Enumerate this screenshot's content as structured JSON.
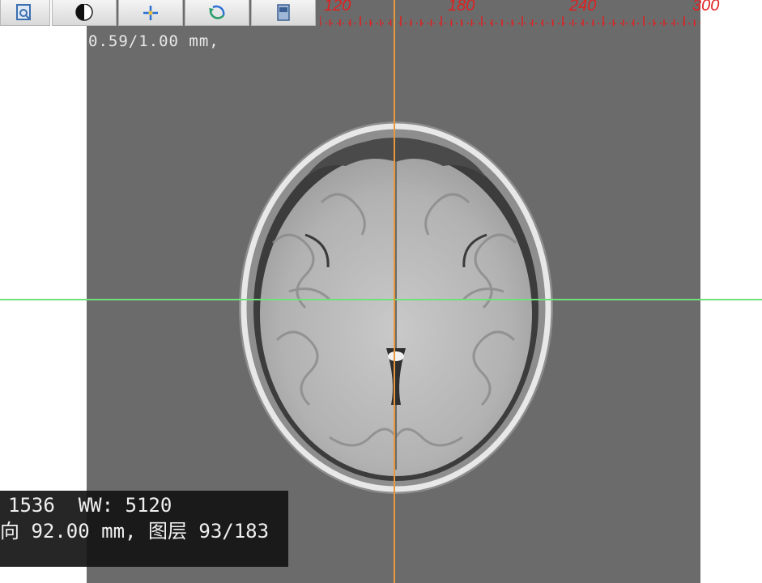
{
  "toolbar": {
    "buttons": [
      {
        "name": "zoom-fit-icon"
      },
      {
        "name": "window-level-icon"
      },
      {
        "name": "pan-crosshair-icon"
      },
      {
        "name": "rotate-icon"
      },
      {
        "name": "layers-icon"
      }
    ]
  },
  "viewport": {
    "pixel_spacing": "0.59/1.00 mm,"
  },
  "ruler": {
    "labels": [
      "120",
      "180",
      "240",
      "300"
    ]
  },
  "info": {
    "line1": "1536  WW: 5120",
    "line2": "向 92.00 mm, 图层 93/183"
  },
  "colors": {
    "crosshair_horizontal": "#6fe07a",
    "crosshair_vertical": "#e69a3e",
    "ruler": "#e02020"
  }
}
